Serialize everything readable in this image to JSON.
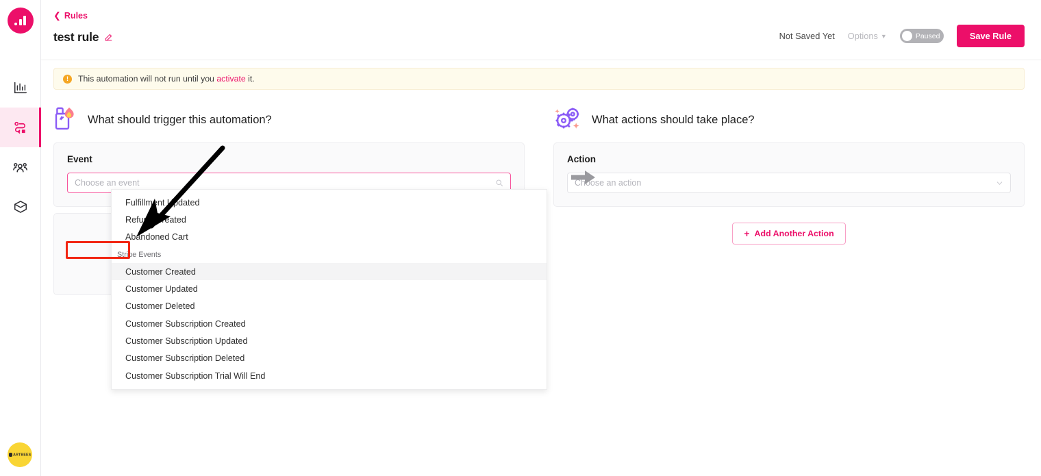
{
  "sidebar": {
    "logo": {
      "name": "omnisend-logo"
    },
    "items": [
      {
        "id": "reports",
        "icon": "bar-chart-icon",
        "active": false
      },
      {
        "id": "automation",
        "icon": "automation-flow-icon",
        "active": true
      },
      {
        "id": "audience",
        "icon": "people-group-icon",
        "active": false
      },
      {
        "id": "products",
        "icon": "package-box-icon",
        "active": false
      }
    ],
    "account_avatar": {
      "label": "ARTBEES"
    }
  },
  "topbar": {
    "breadcrumb_label": "Rules",
    "page_title": "test rule",
    "edit_icon": "pencil-icon",
    "saved_status": "Not Saved Yet",
    "options_label": "Options",
    "toggle_label": "Paused",
    "save_label": "Save Rule"
  },
  "alert": {
    "text_before": "This automation will not run until you ",
    "link": "activate",
    "text_after": " it."
  },
  "trigger": {
    "section_title": "What should trigger this automation?",
    "card_label": "Event",
    "input_placeholder": "Choose an event",
    "input_value": ""
  },
  "action": {
    "section_title": "What actions should take place?",
    "card_label": "Action",
    "input_placeholder": "Choose an action",
    "input_value": "",
    "add_another_label": "Add Another Action"
  },
  "dropdown": {
    "items": [
      {
        "label": "Fulfillment Updated",
        "type": "item",
        "hovered": false
      },
      {
        "label": "Refund Created",
        "type": "item",
        "hovered": false
      },
      {
        "label": "Abandoned Cart",
        "type": "item",
        "hovered": false
      },
      {
        "label": "Stripe Events",
        "type": "group",
        "hovered": false
      },
      {
        "label": "Customer Created",
        "type": "item",
        "hovered": true
      },
      {
        "label": "Customer Updated",
        "type": "item",
        "hovered": false
      },
      {
        "label": "Customer Deleted",
        "type": "item",
        "hovered": false
      },
      {
        "label": "Customer Subscription Created",
        "type": "item",
        "hovered": false
      },
      {
        "label": "Customer Subscription Updated",
        "type": "item",
        "hovered": false
      },
      {
        "label": "Customer Subscription Deleted",
        "type": "item",
        "hovered": false
      },
      {
        "label": "Customer Subscription Trial Will End",
        "type": "item",
        "hovered": false
      }
    ]
  },
  "annotations": {
    "highlight_target": "Stripe Events",
    "highlight_color": "#f22613",
    "arrow_color": "#000000"
  },
  "colors": {
    "brand_pink": "#ec0f69",
    "accent_purple": "#8b5cf6",
    "warning_yellow": "#f5a623",
    "avatar_yellow": "#f9d534"
  }
}
